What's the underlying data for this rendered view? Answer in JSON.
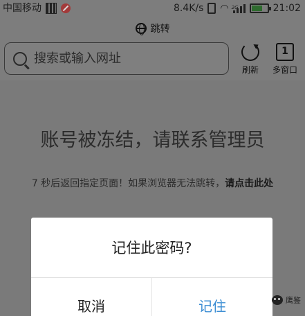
{
  "status_bar": {
    "carrier": "中国移动",
    "speed": "8.4K/s",
    "network_tag": "2G",
    "time": "21:02"
  },
  "toolbar": {
    "title": "跳转",
    "search_placeholder": "搜索或输入网址",
    "refresh_label": "刷新",
    "tabs_count": "1",
    "tabs_label": "多窗口"
  },
  "page": {
    "frozen_message": "账号被冻结，请联系管理员",
    "redirect_text": "7 秒后返回指定页面！如果浏览器无法跳转，",
    "redirect_link": "请点击此处"
  },
  "dialog": {
    "title": "记住此密码?",
    "cancel_label": "取消",
    "remember_label": "记住"
  },
  "watermark": {
    "text": "鹰鉴"
  }
}
